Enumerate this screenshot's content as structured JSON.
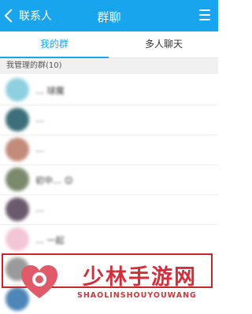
{
  "header": {
    "back_label": "联系人",
    "title": "群聊"
  },
  "tabs": [
    {
      "label": "我的群",
      "active": true
    },
    {
      "label": "多人聊天",
      "active": false
    }
  ],
  "section": {
    "label": "我管理的群(10)"
  },
  "groups": [
    {
      "name": "… 球魔"
    },
    {
      "name": "…"
    },
    {
      "name": "…"
    },
    {
      "name": "初中… 😊"
    },
    {
      "name": "…"
    },
    {
      "name": "… 一起"
    },
    {
      "name": ""
    },
    {
      "name": ""
    }
  ],
  "watermark": {
    "cn": "少林手游网",
    "en": "SHAOLINSHOUYOUWANG"
  },
  "colors": {
    "accent": "#19a5ee",
    "highlight": "#c9262a",
    "watermark": "#d32f3a"
  }
}
